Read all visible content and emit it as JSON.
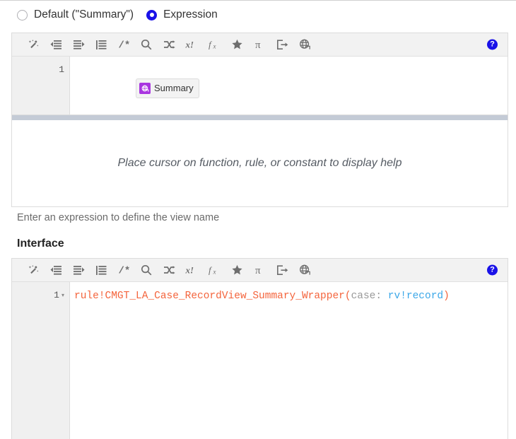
{
  "radio_group": {
    "options": [
      {
        "label": "Default (\"Summary\")",
        "selected": false
      },
      {
        "label": "Expression",
        "selected": true
      }
    ]
  },
  "toolbar": {
    "icons": [
      "magic-wand-icon",
      "outdent-icon",
      "indent-icon",
      "format-lines-icon",
      "comment-icon",
      "search-icon",
      "shuffle-icon",
      "x-exclaim-icon",
      "function-icon",
      "star-icon",
      "pi-icon",
      "export-icon",
      "globe-icon"
    ],
    "help_label": "?"
  },
  "name_editor": {
    "line_number": "1",
    "chip": {
      "icon": "globe-icon",
      "label": "Summary"
    },
    "help_placeholder": "Place cursor on function, rule, or constant to display help"
  },
  "name_hint": "Enter an expression to define the view name",
  "interface_section": {
    "title": "Interface"
  },
  "interface_editor": {
    "line_number": "1",
    "fold_arrow": "▾",
    "code": {
      "rule_name": "rule!CMGT_LA_Case_RecordView_Summary_Wrapper",
      "open_paren": "(",
      "param_name": "case: ",
      "param_value": "rv!record",
      "close_paren": ")"
    }
  },
  "colors": {
    "accent_blue": "#1a12e8",
    "chip_purple": "#a936e0",
    "code_orange": "#f4643c",
    "code_blue": "#3ba7e8",
    "code_gray": "#999999",
    "toolbar_bg": "#f2f2f2",
    "gutter_bg": "#f0f0f0",
    "resize_bar": "#c4cbd6"
  }
}
